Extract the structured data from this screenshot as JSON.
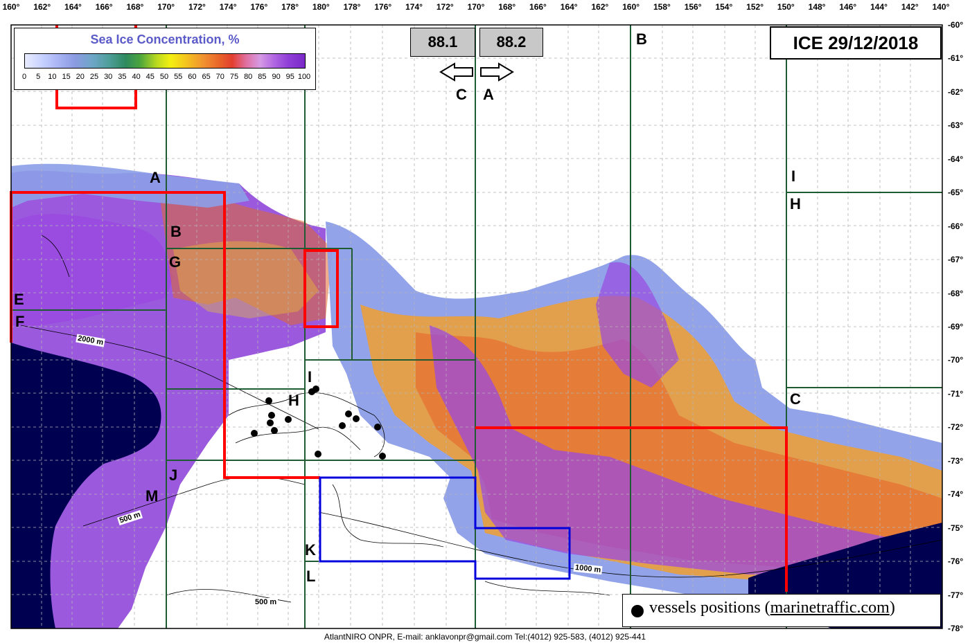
{
  "legend": {
    "title": "Sea Ice Concentration, %",
    "ticks": [
      "0",
      "5",
      "10",
      "15",
      "20",
      "25",
      "30",
      "35",
      "40",
      "45",
      "50",
      "55",
      "60",
      "65",
      "70",
      "75",
      "80",
      "85",
      "90",
      "95",
      "100"
    ]
  },
  "date_label": "ICE 29/12/2018",
  "values": {
    "left": "88.1",
    "right": "88.2"
  },
  "direction_arrows": {
    "left_letter": "C",
    "right_letter": "A"
  },
  "longitude_labels": [
    "160°",
    "162°",
    "164°",
    "166°",
    "168°",
    "170°",
    "172°",
    "174°",
    "176°",
    "178°",
    "180°",
    "178°",
    "176°",
    "174°",
    "172°",
    "170°",
    "168°",
    "166°",
    "164°",
    "162°",
    "160°",
    "158°",
    "156°",
    "154°",
    "152°",
    "150°",
    "148°",
    "146°",
    "144°",
    "142°",
    "140°"
  ],
  "latitude_labels": [
    "-60°",
    "-61°",
    "-62°",
    "-63°",
    "-64°",
    "-65°",
    "-66°",
    "-67°",
    "-68°",
    "-69°",
    "-70°",
    "-71°",
    "-72°",
    "-73°",
    "-74°",
    "-75°",
    "-76°",
    "-77°",
    "-78°"
  ],
  "sector_letters": {
    "A": "A",
    "B": "B",
    "G": "G",
    "E": "E",
    "F": "F",
    "I": "I",
    "H": "H",
    "J": "J",
    "M": "M",
    "K": "K",
    "L": "L",
    "B_right": "B",
    "I_right": "I",
    "H_right": "H",
    "C_right": "C"
  },
  "contour_labels": {
    "c2000": "2000 m",
    "c500a": "500 m",
    "c500b": "500 m",
    "c1000": "1000 m"
  },
  "vessels": {
    "label_prefix": "vessels positions (",
    "link": "marinetraffic.com",
    "label_suffix": ")"
  },
  "footer": "AtlantNIRO ONPR, E-mail: anklavonpr@gmail.com Tel:(4012) 925-583,  (4012) 925-441",
  "colors": {
    "land": "#000050",
    "ice_high": "#8a3cd8",
    "grid_line": "#1e5a32",
    "red_zone": "#ff0000",
    "blue_zone": "#0000dd"
  }
}
